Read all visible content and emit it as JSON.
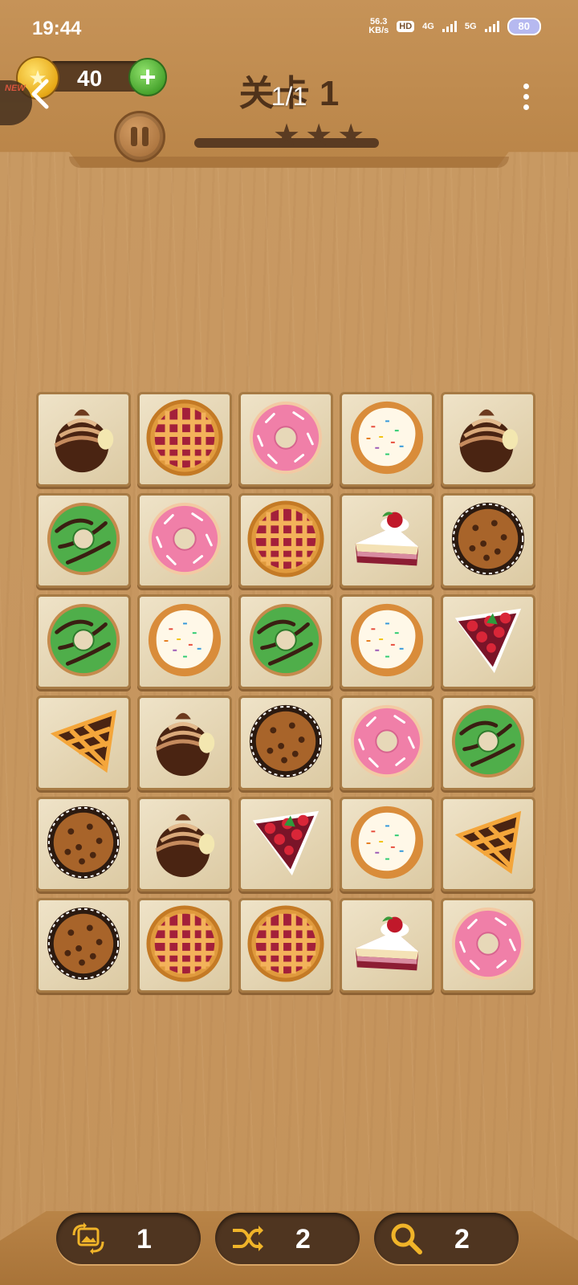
{
  "status_bar": {
    "time": "19:44",
    "speed_value": "56.3",
    "speed_unit": "KB/s",
    "hd_label": "HD",
    "net_4g": "4G",
    "net_5g": "5G",
    "battery": "80"
  },
  "header": {
    "coins": "40",
    "new_tag": "NEW",
    "level_title": "关卡 1",
    "page_indicator": "1/1",
    "star_count": 3,
    "progress": 0.0
  },
  "board": {
    "rows": 6,
    "cols": 5,
    "tiles": [
      [
        "chocolate-truffle",
        "lattice-pie",
        "pink-donut",
        "sprinkle-cookie",
        "chocolate-truffle"
      ],
      [
        "green-donut",
        "pink-donut",
        "lattice-pie",
        "cherry-cake-slice",
        "chocolate-chip-muffin"
      ],
      [
        "green-donut",
        "sprinkle-cookie",
        "green-donut",
        "sprinkle-cookie",
        "strawberry-tart-slice"
      ],
      [
        "pie-slice",
        "chocolate-truffle",
        "chocolate-chip-muffin",
        "pink-donut",
        "green-donut"
      ],
      [
        "chocolate-chip-muffin",
        "chocolate-truffle",
        "strawberry-tart-slice",
        "sprinkle-cookie",
        "pie-slice"
      ],
      [
        "chocolate-chip-muffin",
        "lattice-pie",
        "lattice-pie",
        "cherry-cake-slice",
        "pink-donut"
      ]
    ]
  },
  "tools": [
    {
      "name": "image-swap",
      "icon": "image-swap-icon",
      "count": "1"
    },
    {
      "name": "shuffle",
      "icon": "shuffle-icon",
      "count": "2"
    },
    {
      "name": "search",
      "icon": "search-icon",
      "count": "2"
    }
  ],
  "colors": {
    "wood": "#c99a63",
    "tool_icon": "#f0b429",
    "plus_green": "#43a02a",
    "coin_gold": "#e7a917"
  }
}
